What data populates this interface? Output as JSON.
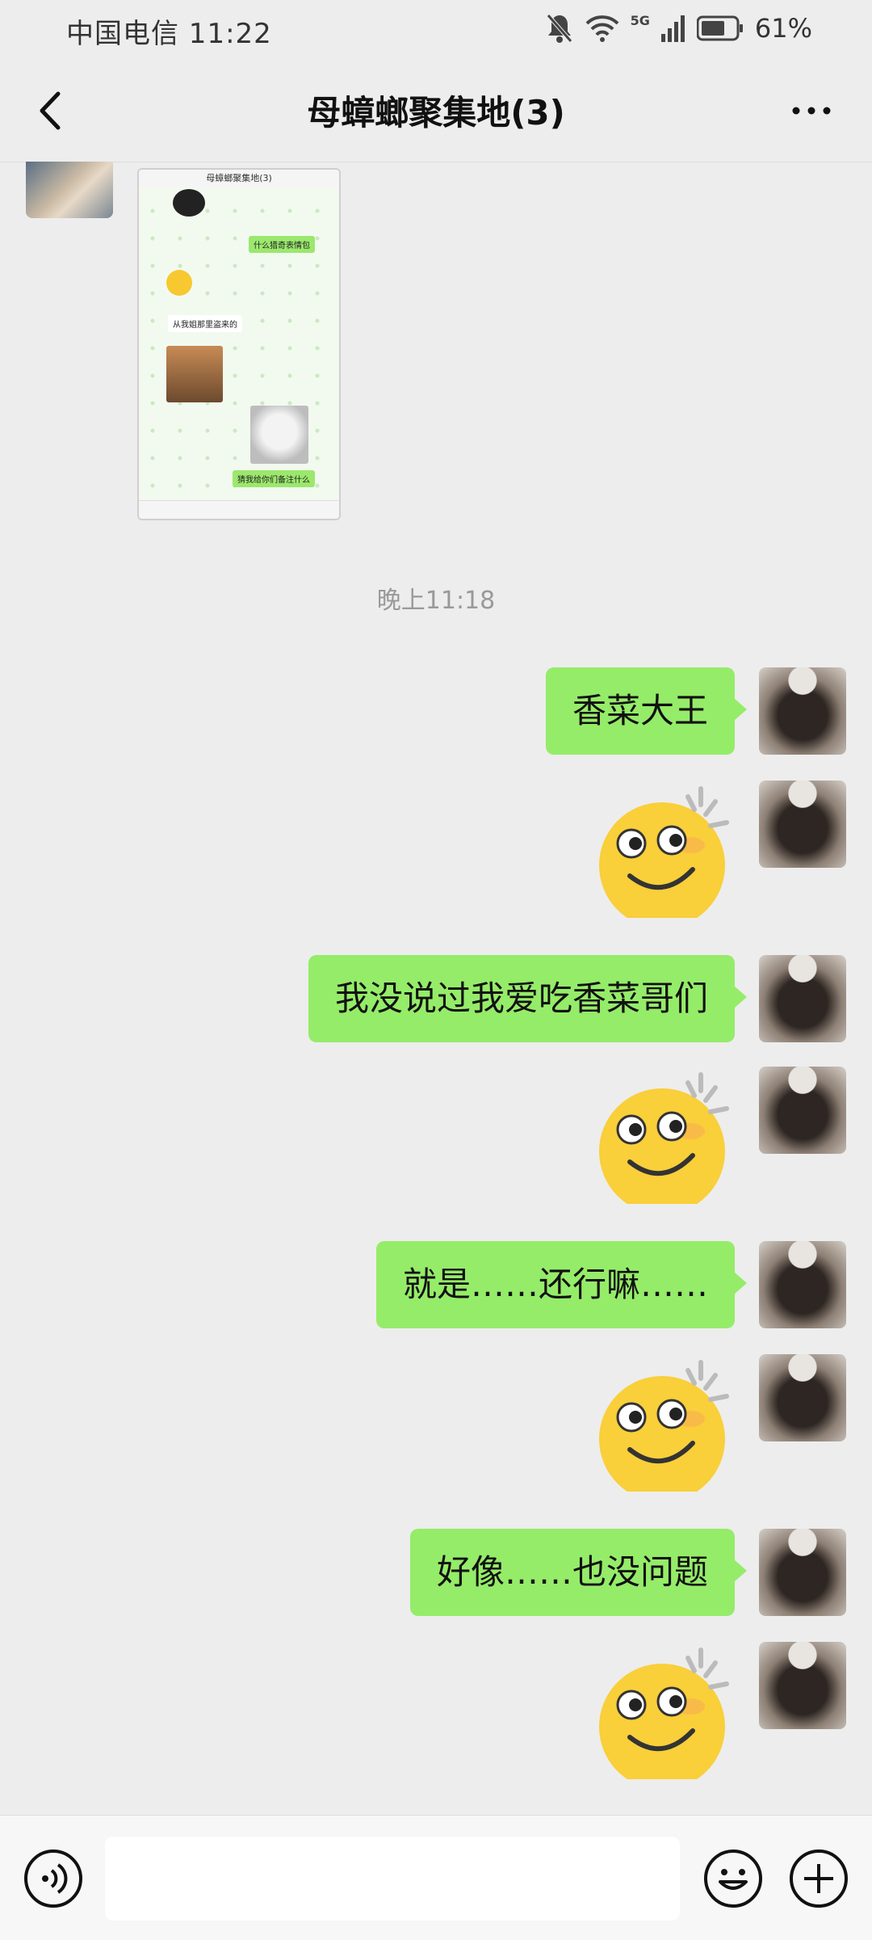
{
  "status_bar": {
    "carrier_time": "中国电信 11:22",
    "network_label": "5G",
    "battery_text": "61%",
    "icons": [
      "bell-muted-icon",
      "wifi-icon",
      "signal-icon",
      "battery-icon"
    ]
  },
  "header": {
    "title": "母蟑螂聚集地(3)",
    "back_icon": "chevron-left-icon",
    "more_icon": "more-dots-icon"
  },
  "shared_image": {
    "title": "母蟑螂聚集地(3)",
    "bubble_1": "什么猎奇表情包",
    "bubble_2": "从我姐那里盗来的",
    "bubble_3": "猜我给你们备注什么"
  },
  "timestamp": "晚上11:18",
  "messages": [
    {
      "type": "text",
      "text": "香菜大王"
    },
    {
      "type": "sticker",
      "name": "sly-smile-emoji"
    },
    {
      "type": "text",
      "text": "我没说过我爱吃香菜哥们"
    },
    {
      "type": "sticker",
      "name": "sly-smile-emoji"
    },
    {
      "type": "text",
      "text": "就是……还行嘛……"
    },
    {
      "type": "sticker",
      "name": "sly-smile-emoji"
    },
    {
      "type": "text",
      "text": "好像……也没问题"
    },
    {
      "type": "sticker",
      "name": "sly-smile-emoji"
    }
  ],
  "input_bar": {
    "value": "",
    "placeholder": "",
    "icons": [
      "voice-icon",
      "emoji-icon",
      "plus-icon"
    ]
  },
  "colors": {
    "background": "#ededed",
    "bubble_green": "#95ec69",
    "timestamp_gray": "#999999"
  }
}
